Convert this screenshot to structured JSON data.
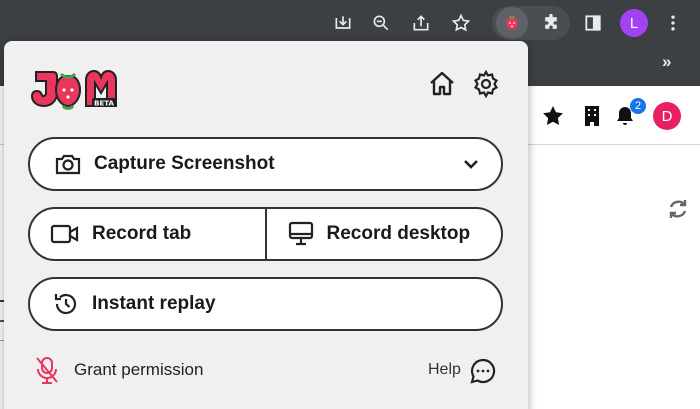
{
  "browser": {
    "profile_initial": "L",
    "profile_color": "#a142f4",
    "toolbar_icons": [
      "download-icon",
      "zoom-out-icon",
      "share-icon",
      "bookmark-star-icon",
      "jam-extension-icon",
      "extensions-puzzle-icon",
      "side-panel-icon",
      "more-menu-icon"
    ]
  },
  "page": {
    "notification_count": "2",
    "user_initial": "D",
    "user_color": "#e91e63",
    "bookmarks_more": "»"
  },
  "popup": {
    "logo_text": "JAM",
    "logo_badge": "BETA",
    "accent_color": "#e8365d",
    "capture_label": "Capture Screenshot",
    "record_tab_label": "Record tab",
    "record_desktop_label": "Record desktop",
    "instant_replay_label": "Instant replay",
    "grant_permission_label": "Grant permission",
    "help_label": "Help"
  }
}
